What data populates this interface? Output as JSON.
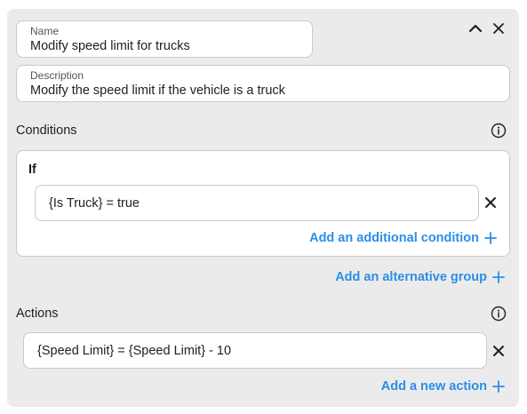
{
  "rule": {
    "name_label": "Name",
    "name_value": "Modify speed limit for trucks",
    "description_label": "Description",
    "description_value": "Modify the speed limit if the vehicle is a truck"
  },
  "conditions": {
    "title": "Conditions",
    "group": {
      "if_label": "If",
      "condition_expression": "{Is Truck} = true",
      "add_condition_label": "Add an additional condition"
    },
    "add_alternative_group_label": "Add an alternative group"
  },
  "actions": {
    "title": "Actions",
    "action_expression": "{Speed Limit} = {Speed Limit} - 10",
    "add_action_label": "Add a new action"
  },
  "icons": {
    "collapse": "chevron-up-icon",
    "close": "close-icon",
    "info": "info-icon",
    "remove": "close-icon",
    "add": "plus-icon"
  },
  "colors": {
    "panel_bg": "#ebebeb",
    "accent": "#2b8fe8",
    "text": "#1f1f1f",
    "border": "#c9c9c9"
  }
}
